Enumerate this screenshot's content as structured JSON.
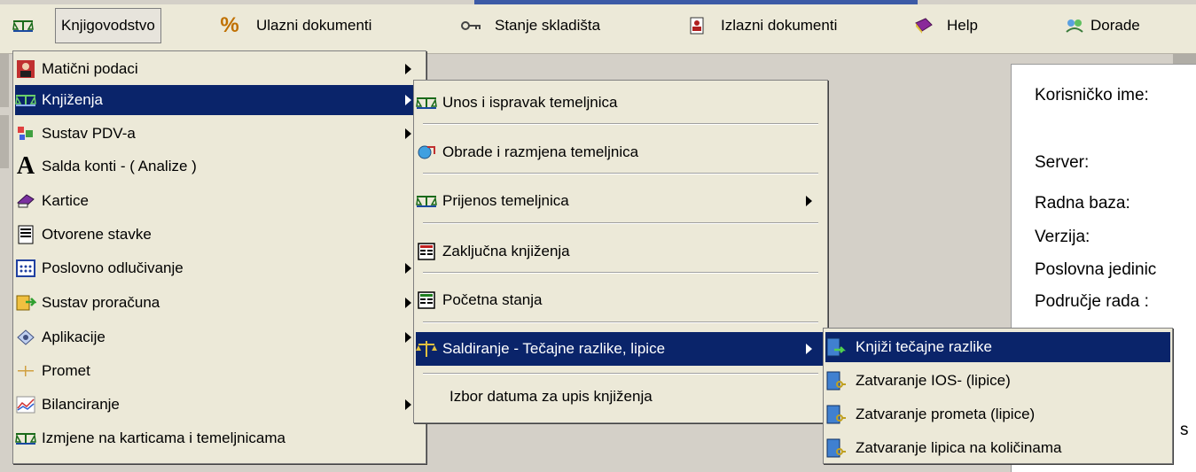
{
  "menubar": {
    "items": [
      {
        "label": "Knjigovodstvo",
        "icon": "scales-icon"
      },
      {
        "label": "Ulazni dokumenti",
        "icon": "percent-icon"
      },
      {
        "label": "Stanje skladišta",
        "icon": "key-icon"
      },
      {
        "label": "Izlazni dokumenti",
        "icon": "document-person-icon"
      },
      {
        "label": "Help",
        "icon": "help-book-icon"
      },
      {
        "label": "Dorade",
        "icon": "refresh-people-icon"
      }
    ]
  },
  "main_menu": {
    "items": [
      {
        "label": "Matični podaci"
      },
      {
        "label": "Knjiženja"
      },
      {
        "label": "Sustav PDV-a"
      },
      {
        "label": "Salda konti - ( Analize )"
      },
      {
        "label": "Kartice"
      },
      {
        "label": "Otvorene stavke"
      },
      {
        "label": "Poslovno odlučivanje"
      },
      {
        "label": "Sustav proračuna"
      },
      {
        "label": "Aplikacije"
      },
      {
        "label": "Promet"
      },
      {
        "label": "Bilanciranje"
      },
      {
        "label": "Izmjene na karticama i temeljnicama"
      }
    ]
  },
  "submenu": {
    "items": [
      {
        "label": "Unos i ispravak temeljnica"
      },
      {
        "label": "Obrade i razmjena temeljnica"
      },
      {
        "label": "Prijenos temeljnica"
      },
      {
        "label": "Zaključna knjiženja"
      },
      {
        "label": "Početna stanja"
      },
      {
        "label": "Saldiranje - Tečajne razlike, lipice"
      },
      {
        "label": "Izbor datuma za upis knjiženja"
      }
    ]
  },
  "submenu2": {
    "items": [
      {
        "label": "Knjiži tečajne razlike"
      },
      {
        "label": "Zatvaranje IOS- (lipice)"
      },
      {
        "label": "Zatvaranje prometa (lipice)"
      },
      {
        "label": "Zatvaranje lipica na količinama"
      }
    ]
  },
  "info_panel": {
    "username_label": "Korisničko ime:",
    "server_label": "Server:",
    "database_label": "Radna baza:",
    "version_label": "Verzija:",
    "unit_label": "Poslovna jedinic",
    "area_label": "Područje rada :",
    "clipped_text": "s"
  }
}
